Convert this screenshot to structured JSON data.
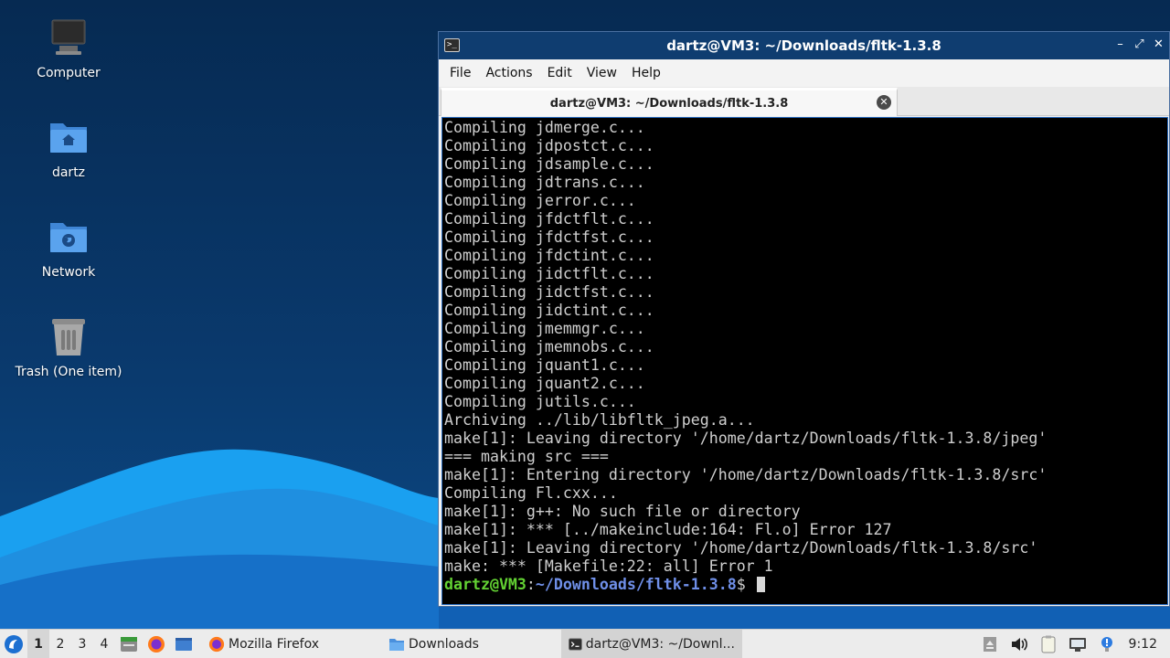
{
  "desktop": {
    "icons": [
      {
        "label": "Computer",
        "icon": "computer-icon"
      },
      {
        "label": "dartz",
        "icon": "home-folder-icon"
      },
      {
        "label": "Network",
        "icon": "network-folder-icon"
      },
      {
        "label": "Trash (One item)",
        "icon": "trash-icon"
      }
    ]
  },
  "window": {
    "title": "dartz@VM3: ~/Downloads/fltk-1.3.8",
    "controls": [
      "minimize",
      "maximize",
      "close"
    ],
    "menu": [
      "File",
      "Actions",
      "Edit",
      "View",
      "Help"
    ],
    "tab_title": "dartz@VM3: ~/Downloads/fltk-1.3.8"
  },
  "terminal": {
    "lines": [
      "Compiling jdmerge.c...",
      "Compiling jdpostct.c...",
      "Compiling jdsample.c...",
      "Compiling jdtrans.c...",
      "Compiling jerror.c...",
      "Compiling jfdctflt.c...",
      "Compiling jfdctfst.c...",
      "Compiling jfdctint.c...",
      "Compiling jidctflt.c...",
      "Compiling jidctfst.c...",
      "Compiling jidctint.c...",
      "Compiling jmemmgr.c...",
      "Compiling jmemnobs.c...",
      "Compiling jquant1.c...",
      "Compiling jquant2.c...",
      "Compiling jutils.c...",
      "Archiving ../lib/libfltk_jpeg.a...",
      "make[1]: Leaving directory '/home/dartz/Downloads/fltk-1.3.8/jpeg'",
      "=== making src ===",
      "make[1]: Entering directory '/home/dartz/Downloads/fltk-1.3.8/src'",
      "Compiling Fl.cxx...",
      "make[1]: g++: No such file or directory",
      "make[1]: *** [../makeinclude:164: Fl.o] Error 127",
      "make[1]: Leaving directory '/home/dartz/Downloads/fltk-1.3.8/src'",
      "make: *** [Makefile:22: all] Error 1"
    ],
    "prompt": {
      "user_host": "dartz@VM3",
      "separator": ":",
      "path": "~/Downloads/fltk-1.3.8",
      "symbol": "$ "
    }
  },
  "taskbar": {
    "workspaces": [
      "1",
      "2",
      "3",
      "4"
    ],
    "active_workspace": "1",
    "tasks": [
      {
        "label": "Mozilla Firefox",
        "icon": "firefox-icon"
      },
      {
        "label": "Downloads",
        "icon": "folder-icon"
      },
      {
        "label": "dartz@VM3: ~/Downl...",
        "icon": "terminal-icon"
      }
    ],
    "clock": "9:12"
  },
  "colors": {
    "titlebar": "#0f3d70",
    "desktop": "#083566",
    "prompt_user": "#63d233",
    "prompt_path": "#6f8fe8",
    "terminal_text": "#cfcfcf"
  }
}
